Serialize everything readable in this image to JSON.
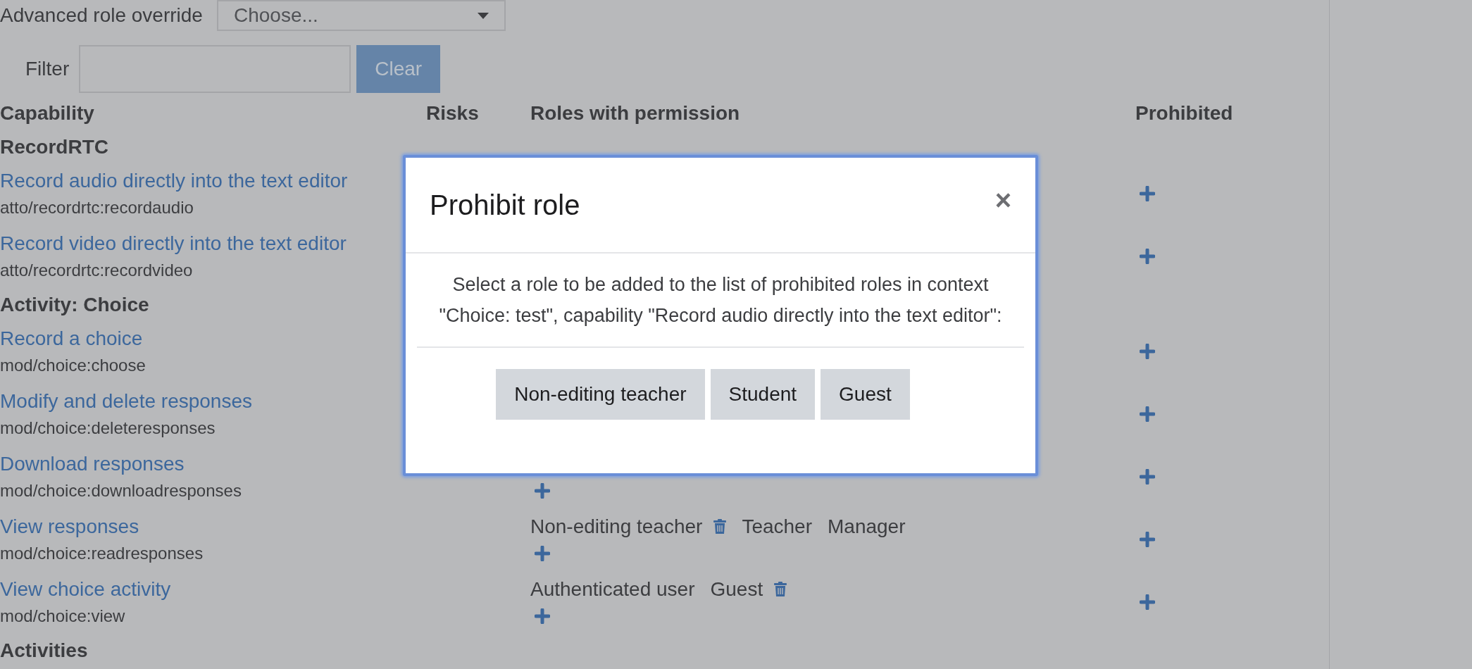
{
  "override": {
    "label": "Advanced role override",
    "value": "Choose..."
  },
  "filter": {
    "label": "Filter",
    "button": "Clear"
  },
  "columns": [
    "Capability",
    "Risks",
    "Roles with permission",
    "Prohibited"
  ],
  "rows": [
    {
      "kind": "heading",
      "title": "RecordRTC"
    },
    {
      "kind": "capability",
      "name": "Record audio directly into the text editor",
      "code": "atto/recordrtc:recordaudio"
    },
    {
      "kind": "capability",
      "name": "Record video directly into the text editor",
      "code": "atto/recordrtc:recordvideo"
    },
    {
      "kind": "heading",
      "title": "Activity: Choice"
    },
    {
      "kind": "capability",
      "name": "Record a choice",
      "code": "mod/choice:choose"
    },
    {
      "kind": "capability",
      "name": "Modify and delete responses",
      "code": "mod/choice:deleteresponses"
    },
    {
      "kind": "capability",
      "name": "Download responses",
      "code": "mod/choice:downloadresponses",
      "role_add": true
    },
    {
      "kind": "capability",
      "name": "View responses",
      "code": "mod/choice:readresponses",
      "role_add": true,
      "roles": [
        {
          "name": "Non-editing teacher",
          "deletable": true
        },
        {
          "name": "Teacher",
          "deletable": false
        },
        {
          "name": "Manager",
          "deletable": false
        }
      ]
    },
    {
      "kind": "capability",
      "name": "View choice activity",
      "code": "mod/choice:view",
      "role_add": true,
      "roles": [
        {
          "name": "Authenticated user",
          "deletable": false
        },
        {
          "name": "Guest",
          "deletable": true
        }
      ]
    },
    {
      "kind": "heading",
      "title": "Activities"
    }
  ],
  "dialog": {
    "title": "Prohibit role",
    "close": "×",
    "message": "Select a role to be added to the list of prohibited roles in context \"Choice: test\", capability \"Record audio directly into the text editor\":",
    "buttons": [
      "Non-editing teacher",
      "Student",
      "Guest"
    ]
  }
}
